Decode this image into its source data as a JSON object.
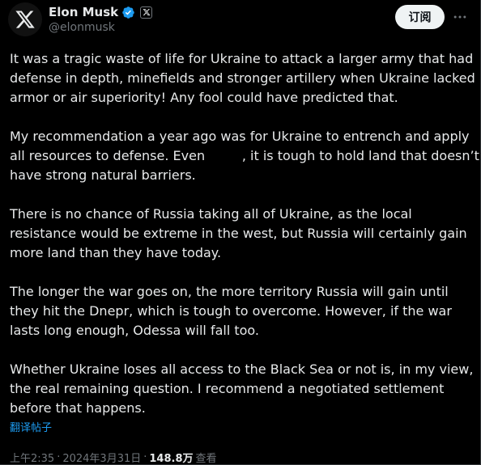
{
  "author": {
    "display_name": "Elon Musk",
    "handle": "@elonmusk",
    "avatar_icon": "x-logo-icon",
    "verified_color": "#1d9bf0"
  },
  "actions": {
    "subscribe_label": "订阅",
    "more_icon": "more-horizontal-icon"
  },
  "tweet": {
    "paragraphs": [
      "It was a tragic waste of life for Ukraine to attack a larger army that had defense in depth, minefields and stronger artillery when Ukraine lacked armor or air superiority! Any fool could have predicted that.",
      "My recommendation a year ago was for Ukraine to entrench and apply all resources to defense. Even         , it is tough to hold land that doesn’t have strong natural barriers.",
      "There is no chance of Russia taking all of Ukraine, as the local resistance would be extreme in the west, but Russia will certainly gain more land than they have today.",
      "The longer the war goes on, the more territory Russia will gain until they hit the Dnepr, which is tough to overcome. However, if the war lasts long enough, Odessa will fall too.",
      "Whether Ukraine loses all access to the Black Sea or not is, in my view, the real remaining question. I recommend a negotiated settlement before that happens."
    ],
    "translate_label": "翻译帖子"
  },
  "meta": {
    "time": "上午2:35",
    "date": "2024年3月31日",
    "separator": "·",
    "views_count": "148.8万",
    "views_label": "查看"
  }
}
